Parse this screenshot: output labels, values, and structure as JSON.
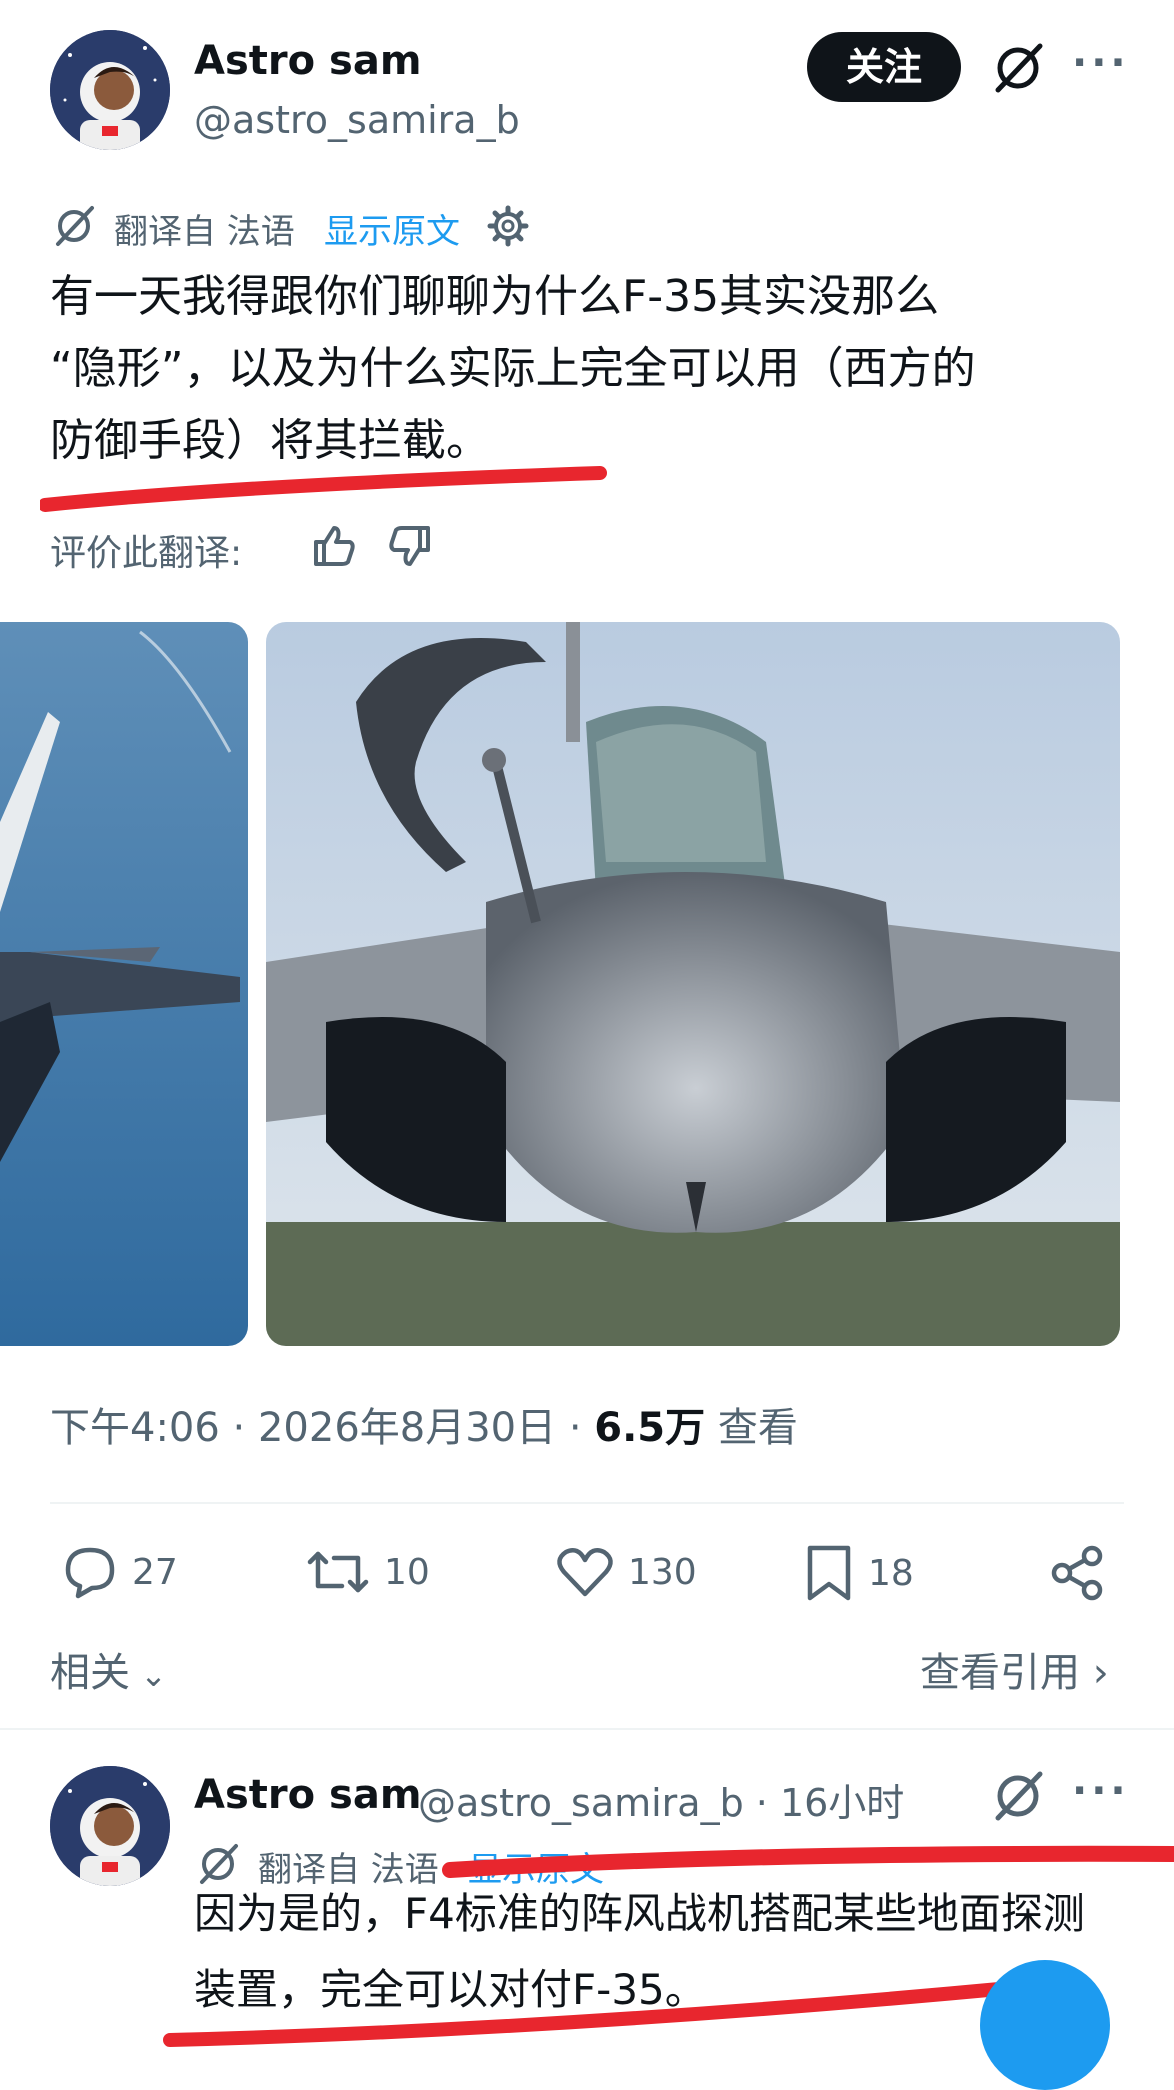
{
  "post": {
    "author_name": "Astro sam",
    "author_handle": "@astro_samira_b",
    "follow_label": "关注",
    "more_label": "···",
    "translation": {
      "from_label": "翻译自 法语",
      "show_original": "显示原文"
    },
    "text_lines": [
      "有一天我得跟你们聊聊为什么F-35其实没那么",
      "“隐形”，以及为什么实际上完全可以用（西方的",
      "防御手段）将其拦截。"
    ],
    "rate_label": "评价此翻译:",
    "timestamp": "下午4:06 · 2026年8月30日 · ",
    "views_count": "6.5万",
    "views_label": " 查看",
    "actions": {
      "replies": "27",
      "reposts": "10",
      "likes": "130",
      "bookmarks": "18"
    },
    "related_label": "相关",
    "view_quotes_label": "查看引用"
  },
  "reply": {
    "author_name": "Astro sam",
    "author_handle_time": "@astro_samira_b · 16小时",
    "more_label": "···",
    "translation": {
      "from_label": "翻译自 法语",
      "show_original": "显示原文"
    },
    "text_lines": [
      "因为是的，F4标准的阵风战机搭配某些地面探测",
      "装置，完全可以对付F-35。"
    ]
  },
  "colors": {
    "accent": "#1d9bf0",
    "annotation_red": "#e8262e",
    "text_primary": "#0f1419",
    "text_secondary": "#536471"
  }
}
